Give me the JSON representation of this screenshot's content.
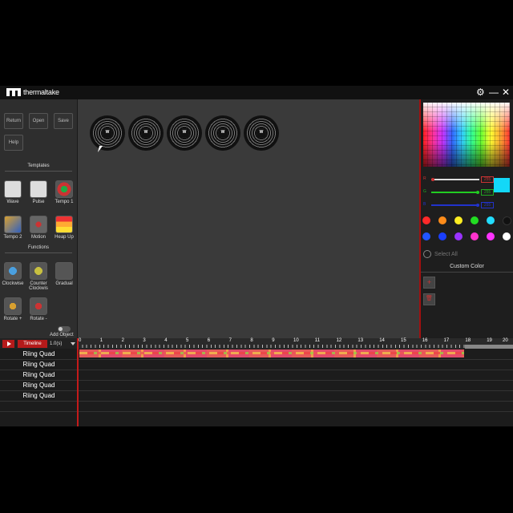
{
  "app": {
    "brand": "thermaltake",
    "window_controls": [
      "⚙",
      "—",
      "✕"
    ]
  },
  "left_panel": {
    "file_buttons": [
      "Return",
      "Open",
      "Save",
      "Help"
    ],
    "templates_title": "Templates",
    "templates": [
      {
        "label": "Wave",
        "icon": "wave-icon"
      },
      {
        "label": "Pulse",
        "icon": "pulse-icon"
      },
      {
        "label": "Tempo 1",
        "icon": "tempo1-icon"
      },
      {
        "label": "Tempo 2",
        "icon": "tempo2-icon"
      },
      {
        "label": "Motion",
        "icon": "motion-icon"
      },
      {
        "label": "Heap Up",
        "icon": "heap-up-icon"
      }
    ],
    "functions_title": "Functions",
    "functions": [
      {
        "label": "Clockwise",
        "icon": "clockwise-icon"
      },
      {
        "label": "Counter Clockwis",
        "icon": "counter-clockwise-icon"
      },
      {
        "label": "Gradual",
        "icon": "gradual-icon"
      },
      {
        "label": "Rotate +",
        "icon": "rotate-plus-icon"
      },
      {
        "label": "Rotate -",
        "icon": "rotate-minus-icon"
      }
    ],
    "add_object": "Add Object"
  },
  "canvas": {
    "fan_logo": "W",
    "fan_count": 5
  },
  "right_panel": {
    "rgb_labels": [
      "R",
      "G",
      "B"
    ],
    "rgb_values": [
      "255",
      "255",
      "255"
    ],
    "preview_color": "#13d8f8",
    "swatches": [
      "#ff2a2a",
      "#ff8c1a",
      "#ffee22",
      "#22dd22",
      "#22ddff",
      "#111111",
      "#2255ff",
      "#1a3fff",
      "#9a33ff",
      "#ff33cc",
      "#ff33ff",
      "#ffffff"
    ],
    "select_all": "Select All",
    "custom_color": "Custom Color",
    "add_btn": "+",
    "delete_btn": "🗑"
  },
  "timeline": {
    "tab": "Timeline",
    "duration": "1.0(s)",
    "ticks": [
      "0",
      "1",
      "2",
      "3",
      "4",
      "5",
      "6",
      "7",
      "8",
      "9",
      "10",
      "11",
      "12",
      "13",
      "14",
      "15",
      "16",
      "17",
      "18",
      "19",
      "20"
    ],
    "tracks": [
      "Riing Quad",
      "Riing Quad",
      "Riing Quad",
      "Riing Quad",
      "Riing Quad"
    ]
  }
}
